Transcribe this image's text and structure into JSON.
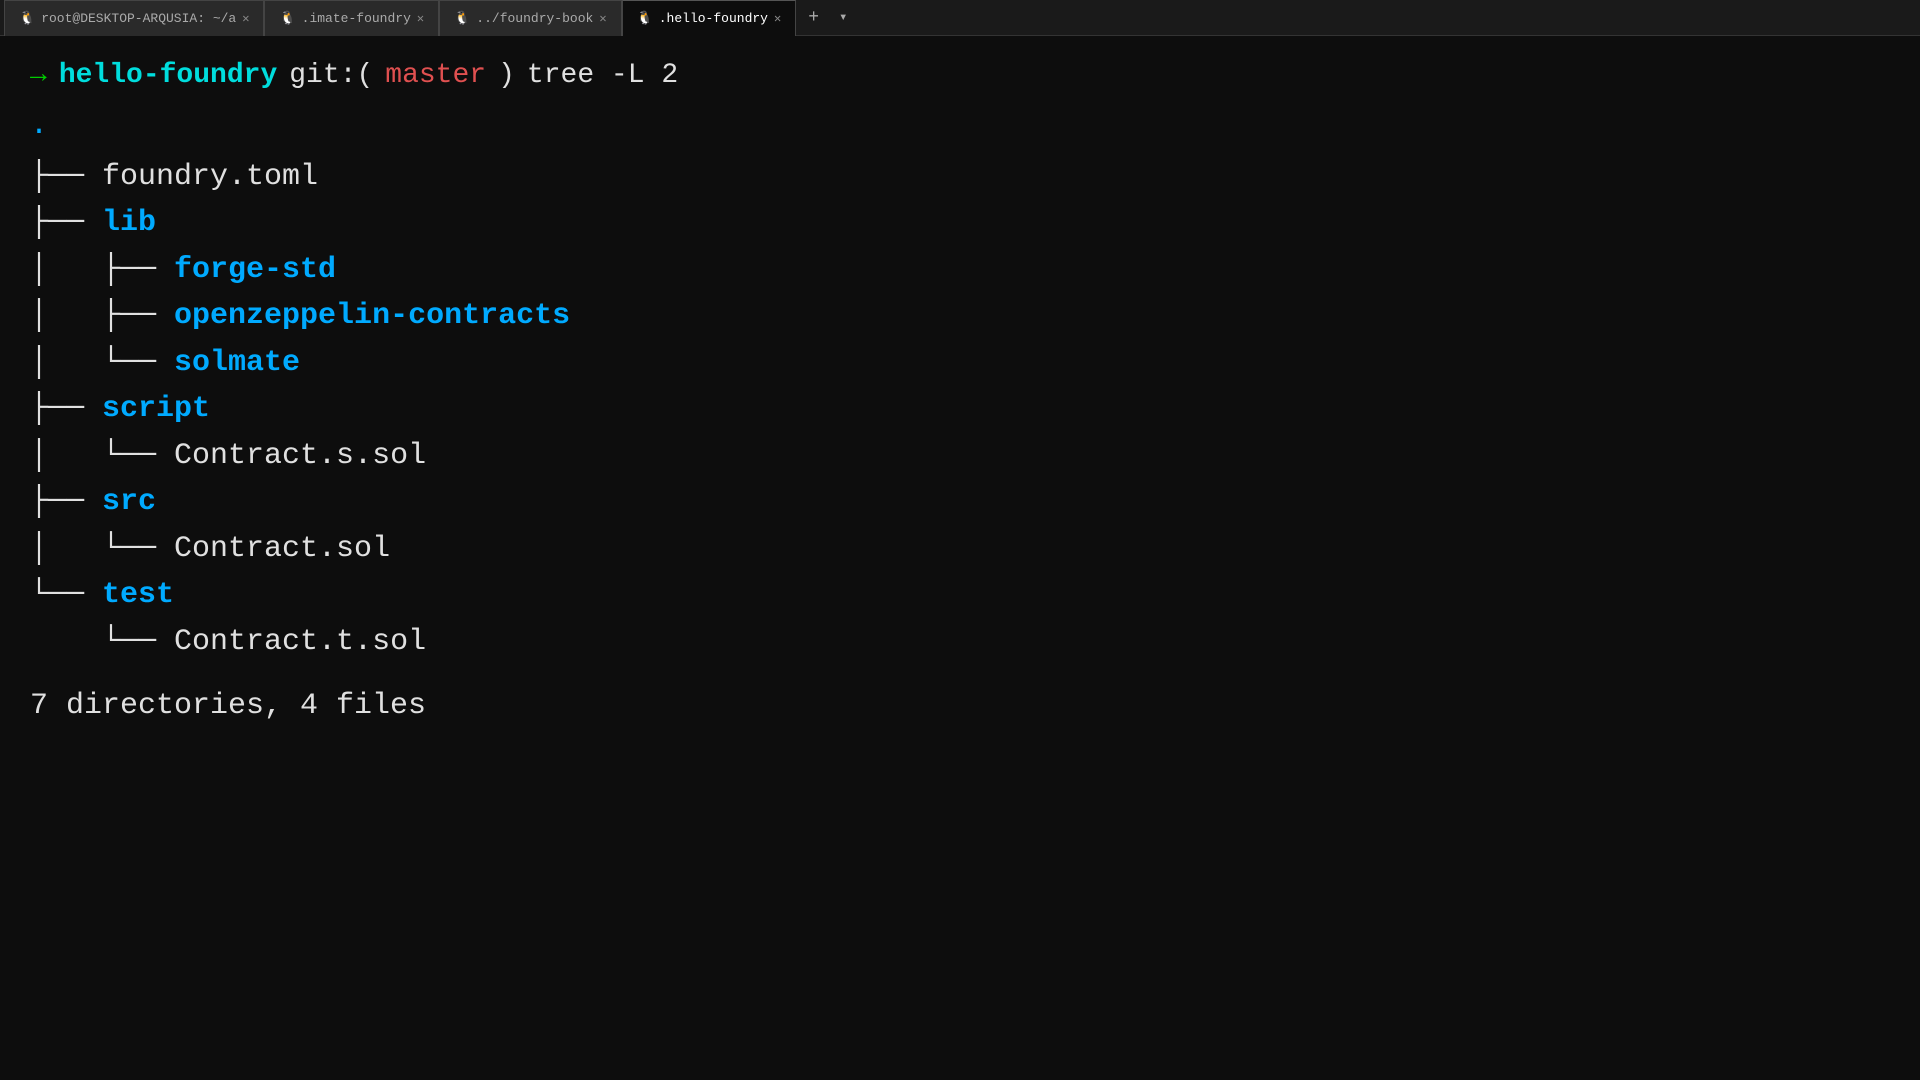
{
  "tabs": [
    {
      "id": "tab1",
      "label": "root@DESKTOP-ARQUSIA: ~/a",
      "icon": "tux",
      "active": false,
      "closable": true
    },
    {
      "id": "tab2",
      "label": ".imate-foundry",
      "icon": "tux",
      "active": false,
      "closable": true
    },
    {
      "id": "tab3",
      "label": "../foundry-book",
      "icon": "tux",
      "active": false,
      "closable": true
    },
    {
      "id": "tab4",
      "label": ".hello-foundry",
      "icon": "tux",
      "active": true,
      "closable": true
    }
  ],
  "prompt": {
    "arrow": "→",
    "dir": "hello-foundry",
    "git_prefix": "git:(",
    "branch": "master",
    "git_suffix": ")",
    "command": "tree -L 2"
  },
  "tree": {
    "dot": ".",
    "items": [
      {
        "connector": "├── ",
        "name": "foundry.toml",
        "type": "file"
      },
      {
        "connector": "├── ",
        "name": "lib",
        "type": "dir"
      },
      {
        "connector": "│   ├── ",
        "name": "forge-std",
        "type": "dir"
      },
      {
        "connector": "│   ├── ",
        "name": "openzeppelin-contracts",
        "type": "dir"
      },
      {
        "connector": "│   └── ",
        "name": "solmate",
        "type": "dir"
      },
      {
        "connector": "├── ",
        "name": "script",
        "type": "dir"
      },
      {
        "connector": "│   └── ",
        "name": "Contract.s.sol",
        "type": "file"
      },
      {
        "connector": "├── ",
        "name": "src",
        "type": "dir"
      },
      {
        "connector": "│   └── ",
        "name": "Contract.sol",
        "type": "file"
      },
      {
        "connector": "└── ",
        "name": "test",
        "type": "dir"
      },
      {
        "connector": "    └── ",
        "name": "Contract.t.sol",
        "type": "file"
      }
    ],
    "summary": "7 directories, 4 files"
  }
}
